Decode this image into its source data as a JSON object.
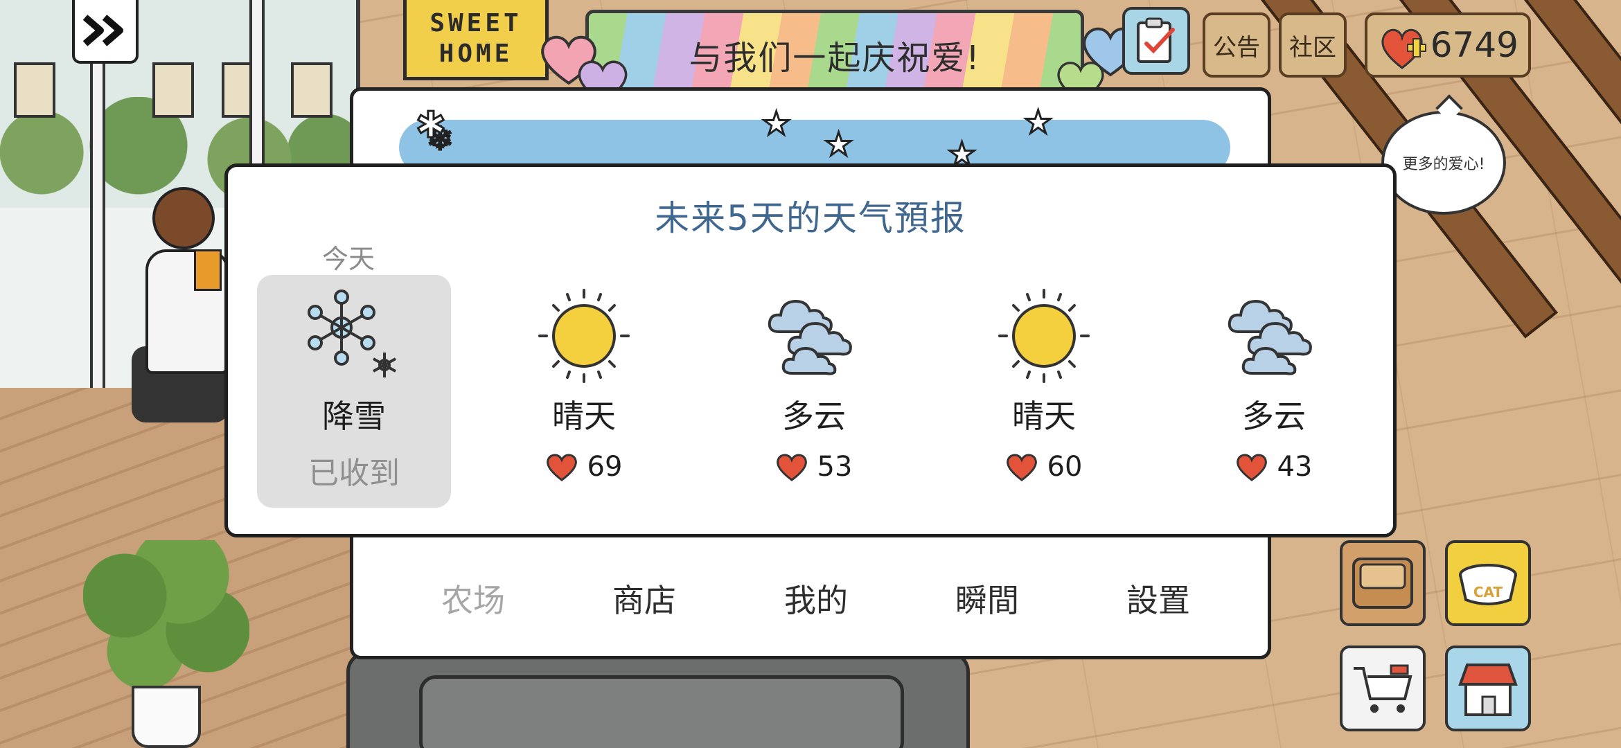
{
  "topbar": {
    "skip_icon": "double-chevron-right-icon",
    "sign_line1": "SWEET",
    "sign_line2": "HOME",
    "banner_text": "与我们一起庆祝爱!",
    "announcement_label": "公告",
    "community_label": "社区",
    "hearts_count": "6749"
  },
  "speech_bubble": "更多的爱心!",
  "menu": {
    "items": [
      {
        "label": "农场",
        "active": false
      },
      {
        "label": "商店"
      },
      {
        "label": "我的"
      },
      {
        "label": "瞬間"
      },
      {
        "label": "設置"
      }
    ]
  },
  "forecast": {
    "title": "未来5天的天气預报",
    "today_label": "今天",
    "days": [
      {
        "weather": "降雪",
        "icon": "snowflake-icon",
        "status": "已收到"
      },
      {
        "weather": "晴天",
        "icon": "sun-icon",
        "hearts": "69"
      },
      {
        "weather": "多云",
        "icon": "cloud-icon",
        "hearts": "53"
      },
      {
        "weather": "晴天",
        "icon": "sun-icon",
        "hearts": "60"
      },
      {
        "weather": "多云",
        "icon": "cloud-icon",
        "hearts": "43"
      }
    ]
  },
  "colors": {
    "title": "#3f6790",
    "heart": "#e2533a",
    "sun": "#f4cf3e",
    "cloud": "#b8d1e6",
    "snow": "#8fc3e6"
  }
}
